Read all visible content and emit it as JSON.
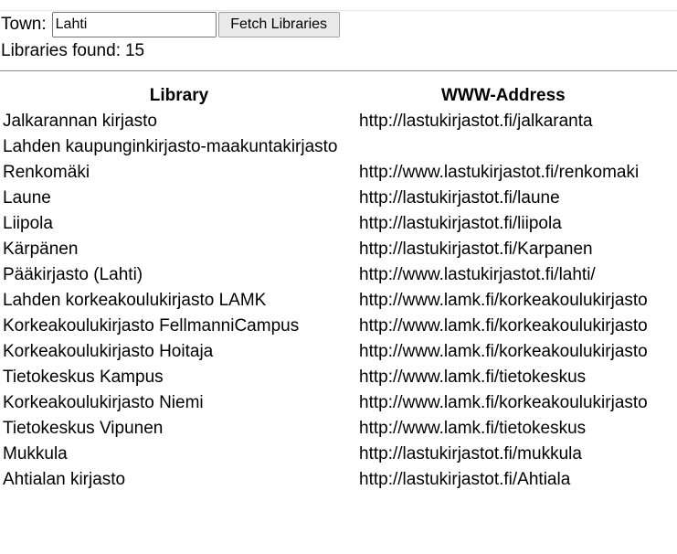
{
  "form": {
    "town_label": "Town:",
    "town_value": "Lahti",
    "fetch_button_label": "Fetch Libraries"
  },
  "result": {
    "found_label": "Libraries found:",
    "found_count": "15"
  },
  "table": {
    "headers": [
      "Library",
      "WWW-Address"
    ],
    "rows": [
      {
        "library": "Jalkarannan kirjasto",
        "url": "http://lastukirjastot.fi/jalkaranta"
      },
      {
        "library": "Lahden kaupunginkirjasto-maakuntakirjasto",
        "url": ""
      },
      {
        "library": "Renkomäki",
        "url": "http://www.lastukirjastot.fi/renkomaki"
      },
      {
        "library": "Laune",
        "url": "http://lastukirjastot.fi/laune"
      },
      {
        "library": "Liipola",
        "url": "http://lastukirjastot.fi/liipola"
      },
      {
        "library": "Kärpänen",
        "url": "http://lastukirjastot.fi/Karpanen"
      },
      {
        "library": "Pääkirjasto (Lahti)",
        "url": "http://www.lastukirjastot.fi/lahti/"
      },
      {
        "library": "Lahden korkeakoulukirjasto LAMK",
        "url": "http://www.lamk.fi/korkeakoulukirjasto"
      },
      {
        "library": "Korkeakoulukirjasto FellmanniCampus",
        "url": "http://www.lamk.fi/korkeakoulukirjasto"
      },
      {
        "library": "Korkeakoulukirjasto Hoitaja",
        "url": "http://www.lamk.fi/korkeakoulukirjasto"
      },
      {
        "library": "Tietokeskus Kampus",
        "url": "http://www.lamk.fi/tietokeskus"
      },
      {
        "library": "Korkeakoulukirjasto Niemi",
        "url": "http://www.lamk.fi/korkeakoulukirjasto"
      },
      {
        "library": "Tietokeskus Vipunen",
        "url": "http://www.lamk.fi/tietokeskus"
      },
      {
        "library": "Mukkula",
        "url": "http://lastukirjastot.fi/mukkula"
      },
      {
        "library": "Ahtialan kirjasto",
        "url": "http://lastukirjastot.fi/Ahtiala"
      }
    ]
  }
}
